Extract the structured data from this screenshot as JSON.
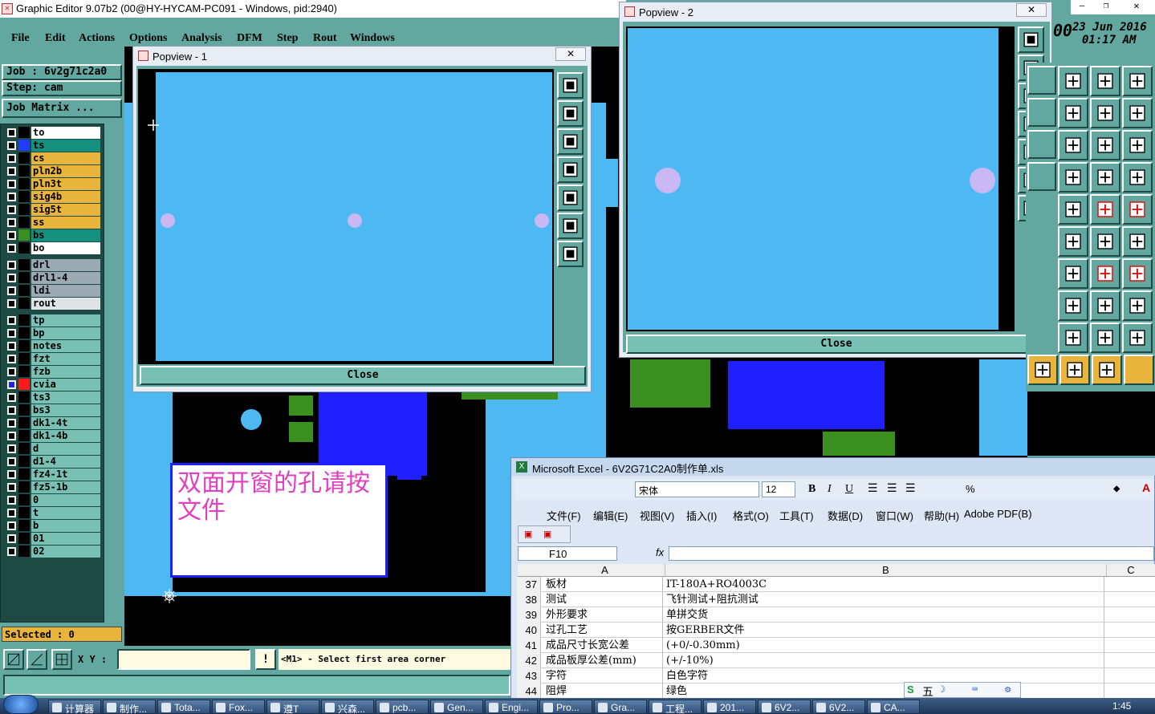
{
  "app": {
    "title": "Graphic Editor 9.07b2 (00@HY-HYCAM-PC091 - Windows, pid:2940)",
    "menu": [
      "File",
      "Edit",
      "Actions",
      "Options",
      "Analysis",
      "DFM",
      "Step",
      "Rout",
      "Windows"
    ],
    "date": "23 Jun 2016",
    "time": "01:17 AM",
    "clock_prefix": "00"
  },
  "left_panel": {
    "job": "Job : 6v2g71c2a0",
    "step": "Step: cam",
    "job_matrix": "Job Matrix ...",
    "selected": "Selected : 0",
    "layers": [
      {
        "name": "to",
        "color": "#000000",
        "bg": "#ffffff"
      },
      {
        "name": "ts",
        "color": "#1f3cff",
        "bg": "#16907e"
      },
      {
        "name": "cs",
        "color": "#000000",
        "bg": "#e9b43c"
      },
      {
        "name": "pln2b",
        "color": "#000000",
        "bg": "#e9b43c"
      },
      {
        "name": "pln3t",
        "color": "#000000",
        "bg": "#e9b43c"
      },
      {
        "name": "sig4b",
        "color": "#000000",
        "bg": "#e9b43c"
      },
      {
        "name": "sig5t",
        "color": "#000000",
        "bg": "#e9b43c"
      },
      {
        "name": "ss",
        "color": "#000000",
        "bg": "#e9b43c"
      },
      {
        "name": "bs",
        "color": "#3a8f1f",
        "bg": "#16907e"
      },
      {
        "name": "bo",
        "color": "#000000",
        "bg": "#ffffff"
      },
      {
        "name": "drl",
        "color": "#000000",
        "bg": "#9aa9b4"
      },
      {
        "name": "drl1-4",
        "color": "#000000",
        "bg": "#9aa9b4"
      },
      {
        "name": "ldi",
        "color": "#000000",
        "bg": "#9aa9b4"
      },
      {
        "name": "rout",
        "color": "#000000",
        "bg": "#dfe3e6"
      },
      {
        "name": "tp",
        "color": "#000000",
        "bg": "#79c0b4"
      },
      {
        "name": "bp",
        "color": "#000000",
        "bg": "#79c0b4"
      },
      {
        "name": "notes",
        "color": "#000000",
        "bg": "#79c0b4"
      },
      {
        "name": "fzt",
        "color": "#000000",
        "bg": "#79c0b4"
      },
      {
        "name": "fzb",
        "color": "#000000",
        "bg": "#79c0b4"
      },
      {
        "name": "cvia",
        "color": "#ff1a1a",
        "bg": "#79c0b4"
      },
      {
        "name": "ts3",
        "color": "#000000",
        "bg": "#79c0b4"
      },
      {
        "name": "bs3",
        "color": "#000000",
        "bg": "#79c0b4"
      },
      {
        "name": "dk1-4t",
        "color": "#000000",
        "bg": "#79c0b4"
      },
      {
        "name": "dk1-4b",
        "color": "#000000",
        "bg": "#79c0b4"
      },
      {
        "name": "d",
        "color": "#000000",
        "bg": "#79c0b4"
      },
      {
        "name": "d1-4",
        "color": "#000000",
        "bg": "#79c0b4"
      },
      {
        "name": "fz4-1t",
        "color": "#000000",
        "bg": "#79c0b4"
      },
      {
        "name": "fz5-1b",
        "color": "#000000",
        "bg": "#79c0b4"
      },
      {
        "name": "0",
        "color": "#000000",
        "bg": "#79c0b4"
      },
      {
        "name": "t",
        "color": "#000000",
        "bg": "#79c0b4"
      },
      {
        "name": "b",
        "color": "#000000",
        "bg": "#79c0b4"
      },
      {
        "name": "01",
        "color": "#000000",
        "bg": "#79c0b4"
      },
      {
        "name": "02",
        "color": "#000000",
        "bg": "#79c0b4"
      }
    ]
  },
  "popview1": {
    "title": "Popview - 1",
    "close": "Close"
  },
  "popview2": {
    "title": "Popview - 2",
    "close": "Close"
  },
  "note": {
    "text": "双面开窗的孔请按文件"
  },
  "status": {
    "xy_label": "X Y :",
    "xy_value": "",
    "message": "<M1> - Select first area corner"
  },
  "excel": {
    "title": "Microsoft Excel - 6V2G71C2A0制作单.xls",
    "font": "宋体",
    "size": "12",
    "menu": [
      "文件(F)",
      "编辑(E)",
      "视图(V)",
      "插入(I)",
      "格式(O)",
      "工具(T)",
      "数据(D)",
      "窗口(W)",
      "帮助(H)",
      "Adobe PDF(B)"
    ],
    "cell_ref": "F10",
    "fx": "fx",
    "cols": [
      "A",
      "B",
      "C"
    ],
    "rows": [
      {
        "n": "37",
        "a": "板材",
        "b": "IT-180A+RO4003C"
      },
      {
        "n": "38",
        "a": "测试",
        "b": "飞针测试+阻抗测试"
      },
      {
        "n": "39",
        "a": "外形要求",
        "b": "单拼交货"
      },
      {
        "n": "40",
        "a": "过孔工艺",
        "b": "按GERBER文件"
      },
      {
        "n": "41",
        "a": "成品尺寸长宽公差",
        "b": "(+0/-0.30mm)"
      },
      {
        "n": "42",
        "a": "成品板厚公差(mm)",
        "b": "(+/-10%)"
      },
      {
        "n": "43",
        "a": "字符",
        "b": "白色字符"
      },
      {
        "n": "44",
        "a": "阻焊",
        "b": "绿色"
      }
    ],
    "ime": "五"
  },
  "taskbar": {
    "items": [
      "计算器",
      "制作...",
      "Tota...",
      "Fox...",
      "遵T",
      "兴森...",
      "pcb...",
      "Gen...",
      "Engi...",
      "Pro...",
      "Gra...",
      "工程...",
      "201...",
      "6V2...",
      "6V2...",
      "CA..."
    ],
    "clock": "1:45"
  },
  "colors": {
    "panel": "#62a8a0",
    "canvas": "#4db8f2",
    "pad": "#c9b8f4",
    "copper_blue": "#1f1fff",
    "green": "#3a8f1f"
  }
}
